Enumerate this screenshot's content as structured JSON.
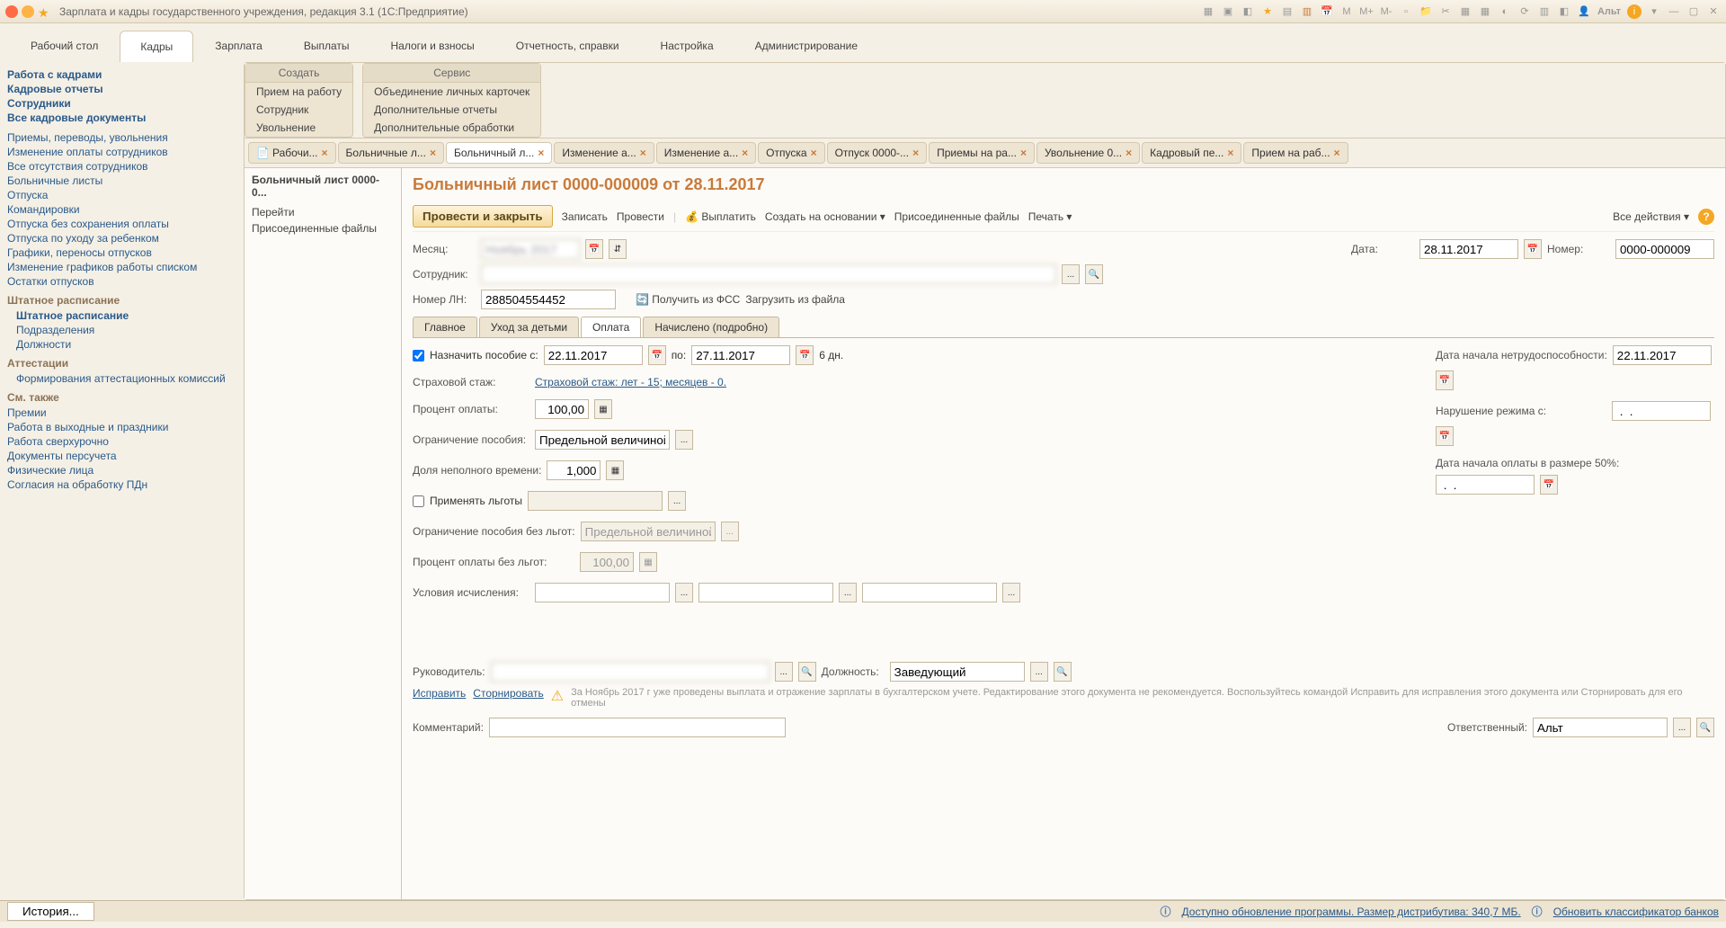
{
  "titlebar": {
    "title": "Зарплата и кадры государственного учреждения, редакция 3.1  (1С:Предприятие)",
    "user": "Альт"
  },
  "main_tabs": [
    "Рабочий стол",
    "Кадры",
    "Зарплата",
    "Выплаты",
    "Налоги и взносы",
    "Отчетность, справки",
    "Настройка",
    "Администрирование"
  ],
  "submenus": {
    "create": {
      "header": "Создать",
      "items": [
        "Прием на работу",
        "Сотрудник",
        "Увольнение"
      ]
    },
    "service": {
      "header": "Сервис",
      "items": [
        "Объединение личных карточек",
        "Дополнительные отчеты",
        "Дополнительные обработки"
      ]
    }
  },
  "sidebar": {
    "top": [
      "Работа с кадрами",
      "Кадровые отчеты",
      "Сотрудники",
      "Все кадровые документы"
    ],
    "mid": [
      "Приемы, переводы, увольнения",
      "Изменение оплаты сотрудников",
      "Все отсутствия сотрудников",
      "Больничные листы",
      "Отпуска",
      "Командировки",
      "Отпуска без сохранения оплаты",
      "Отпуска по уходу за ребенком",
      "Графики, переносы отпусков",
      "Изменение графиков работы списком",
      "Остатки отпусков"
    ],
    "staff_header": "Штатное расписание",
    "staff": [
      "Штатное расписание",
      "Подразделения",
      "Должности"
    ],
    "att_header": "Аттестации",
    "att": [
      "Формирования аттестационных комиссий"
    ],
    "also_header": "См. также",
    "also": [
      "Премии",
      "Работа в выходные и праздники",
      "Работа сверхурочно",
      "Документы персучета",
      "Физические лица",
      "Согласия на обработку ПДн"
    ]
  },
  "doc_tabs": [
    "Рабочи...",
    "Больничные л...",
    "Больничный л...",
    "Изменение а...",
    "Изменение а...",
    "Отпуска",
    "Отпуск 0000-...",
    "Приемы на ра...",
    "Увольнение 0...",
    "Кадровый пе...",
    "Прием на раб..."
  ],
  "nav_side": {
    "header": "Больничный лист 0000-0...",
    "items": [
      "Перейти",
      "Присоединенные файлы"
    ]
  },
  "form": {
    "title": "Больничный лист 0000-000009 от 28.11.2017",
    "toolbar": {
      "primary": "Провести и закрыть",
      "write": "Записать",
      "post": "Провести",
      "pay": "Выплатить",
      "create_based": "Создать на основании",
      "files": "Присоединенные файлы",
      "print": "Печать",
      "all_actions": "Все действия"
    },
    "labels": {
      "month": "Месяц:",
      "date": "Дата:",
      "number": "Номер:",
      "employee": "Сотрудник:",
      "ln_number": "Номер ЛН:",
      "get_fss": "Получить из ФСС",
      "load_file": "Загрузить из файла",
      "assign": "Назначить пособие с:",
      "to": "по:",
      "days": "6 дн.",
      "start_disability": "Дата начала нетрудоспособности:",
      "insurance": "Страховой стаж:",
      "insurance_link": "Страховой стаж: лет - 15; месяцев - 0.",
      "violation": "Нарушение режима с:",
      "percent": "Процент оплаты:",
      "start_50": "Дата начала оплаты в размере 50%:",
      "limit": "Ограничение пособия:",
      "parttime": "Доля неполного времени:",
      "apply_benefits": "Применять льготы",
      "limit_no_benefits": "Ограничение пособия без льгот:",
      "percent_no_benefits": "Процент оплаты без льгот:",
      "conditions": "Условия исчисления:",
      "head": "Руководитель:",
      "position": "Должность:",
      "fix": "Исправить",
      "reverse": "Сторнировать",
      "warning": "За Ноябрь 2017 г уже проведены выплата и отражение зарплаты в бухгалтерском учете. Редактирование этого документа не рекомендуется. Воспользуйтесь командой Исправить для исправления этого документа или Сторнировать для его отмены",
      "comment": "Комментарий:",
      "responsible": "Ответственный:"
    },
    "values": {
      "month": "Ноябрь 2017",
      "date": "28.11.2017",
      "number": "0000-000009",
      "ln_number": "288504554452",
      "from_date": "22.11.2017",
      "to_date": "27.11.2017",
      "disability_date": "22.11.2017",
      "violation_date": " .  .",
      "percent": "100,00",
      "date_50": " .  .",
      "limit": "Предельной величиной б",
      "parttime": "1,000",
      "limit_no_benefits": "Предельной величиной б",
      "percent_no_benefits": "100,00",
      "position": "Заведующий",
      "responsible": "Альт"
    },
    "tabs": [
      "Главное",
      "Уход за детьми",
      "Оплата",
      "Начислено (подробно)"
    ]
  },
  "statusbar": {
    "history": "История...",
    "update": "Доступно обновление программы. Размер дистрибутива: 340,7 МБ.",
    "classifier": "Обновить классификатор банков"
  }
}
